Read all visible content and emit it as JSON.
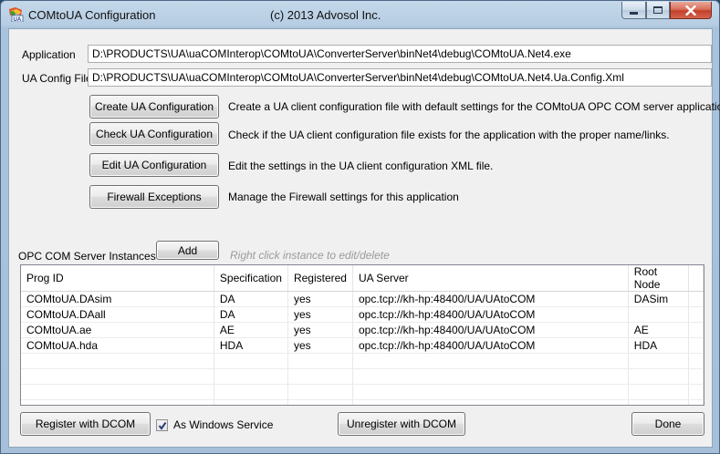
{
  "window": {
    "title": "COMtoUA Configuration",
    "copyright": "(c) 2013 Advosol Inc."
  },
  "fields": {
    "application_label": "Application",
    "application_value": "D:\\PRODUCTS\\UA\\uaCOMInterop\\COMtoUA\\ConverterServer\\binNet4\\debug\\COMtoUA.Net4.exe",
    "config_label": "UA Config File",
    "config_value": "D:\\PRODUCTS\\UA\\uaCOMInterop\\COMtoUA\\ConverterServer\\binNet4\\debug\\COMtoUA.Net4.Ua.Config.Xml"
  },
  "actions": [
    {
      "label": "Create UA Configuration",
      "description": "Create a UA client configuration file with default settings for the COMtoUA OPC COM server application."
    },
    {
      "label": "Check UA Configuration",
      "description": "Check if the UA client configuration file exists for the application with the proper name/links."
    },
    {
      "label": "Edit UA Configuration",
      "description": "Edit the settings in the UA client configuration XML file."
    },
    {
      "label": "Firewall Exceptions",
      "description": "Manage the Firewall settings for this application"
    }
  ],
  "instances": {
    "section_label": "OPC COM Server Instances",
    "add_label": "Add",
    "hint": "Right click instance to edit/delete",
    "columns": [
      "Prog ID",
      "Specification",
      "Registered",
      "UA Server",
      "Root Node"
    ],
    "rows": [
      [
        "COMtoUA.DAsim",
        "DA",
        "yes",
        "opc.tcp://kh-hp:48400/UA/UAtoCOM",
        "DASim"
      ],
      [
        "COMtoUA.DAall",
        "DA",
        "yes",
        "opc.tcp://kh-hp:48400/UA/UAtoCOM",
        ""
      ],
      [
        "COMtoUA.ae",
        "AE",
        "yes",
        "opc.tcp://kh-hp:48400/UA/UAtoCOM",
        "AE"
      ],
      [
        "COMtoUA.hda",
        "HDA",
        "yes",
        "opc.tcp://kh-hp:48400/UA/UAtoCOM",
        "HDA"
      ]
    ]
  },
  "footer": {
    "register_label": "Register with DCOM",
    "service_label": "As Windows Service",
    "service_checked": true,
    "unregister_label": "Unregister with DCOM",
    "done_label": "Done"
  }
}
